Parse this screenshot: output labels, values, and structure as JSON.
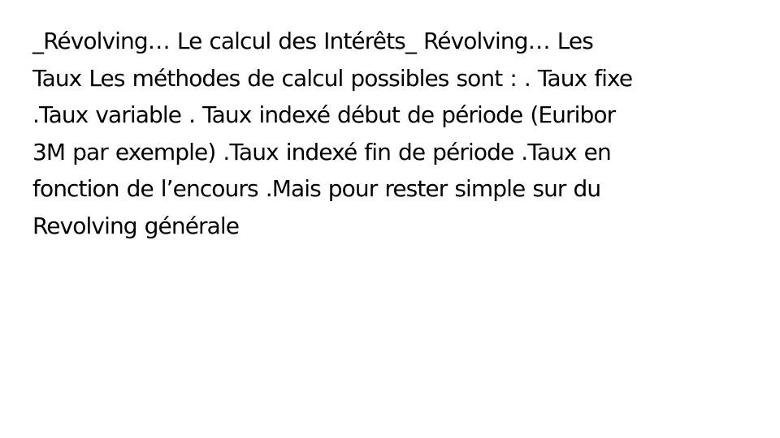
{
  "slide": {
    "text_lines": [
      "_Révolving… Le calcul des Intérêts_ Révolving… Les",
      "Taux Les méthodes de calcul possibles sont : . Taux fixe",
      ".Taux variable . Taux indexé début de période (Euribor",
      "3M par exemple) .Taux indexé fin de période .Taux en",
      "fonction de l’encours .Mais pour rester simple sur du",
      "Revolving générale"
    ]
  }
}
